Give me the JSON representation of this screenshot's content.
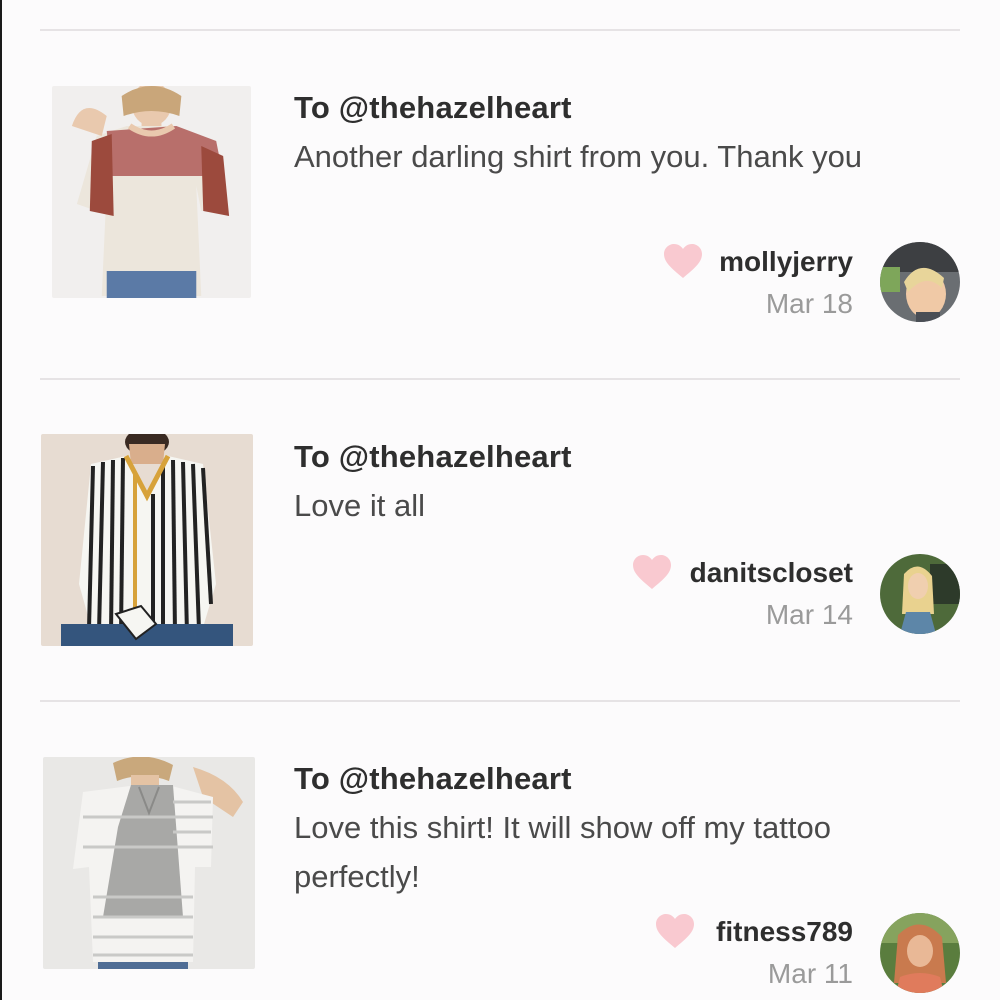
{
  "feed": {
    "items": [
      {
        "to": "To @thehazelheart",
        "message": "Another darling shirt from you. Thank you",
        "username": "mollyjerry",
        "date": "Mar 18",
        "product_icon": "shirt-pink-lace-sleeve-image"
      },
      {
        "to": "To @thehazelheart",
        "message": "Love it all",
        "username": "danitscloset",
        "date": "Mar 14",
        "product_icon": "shirt-black-white-stripe-image"
      },
      {
        "to": "To @thehazelheart",
        "message": "Love this shirt! It will show off my tattoo perfectly!",
        "username": "fitness789",
        "date": "Mar 11",
        "product_icon": "shirt-gray-stripe-back-image"
      }
    ]
  },
  "colors": {
    "heart": "#f9c9d0",
    "divider": "#e6e3e5",
    "background": "#fcfbfc"
  }
}
